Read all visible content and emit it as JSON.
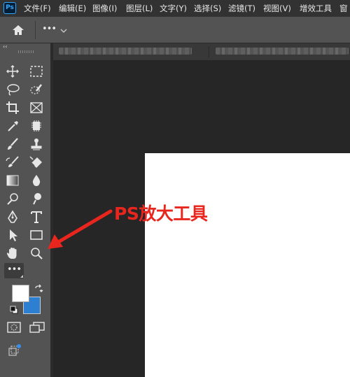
{
  "app": {
    "logo_text": "Ps"
  },
  "menu": {
    "items": [
      {
        "label": "文件(F)"
      },
      {
        "label": "编辑(E)"
      },
      {
        "label": "图像(I)"
      },
      {
        "label": "图层(L)"
      },
      {
        "label": "文字(Y)"
      },
      {
        "label": "选择(S)"
      },
      {
        "label": "滤镜(T)"
      },
      {
        "label": "视图(V)"
      },
      {
        "label": "增效工具"
      },
      {
        "label": "窗"
      }
    ]
  },
  "options_bar": {
    "home_icon": "home-icon",
    "more_label": "•••"
  },
  "toolbar": {
    "collapse_label": "‹‹",
    "more_tools_label": "•••",
    "foreground_color": "#ffffff",
    "background_color": "#2d7fd1"
  },
  "annotation": {
    "label": "PS放大工具",
    "color": "#e8261e"
  }
}
